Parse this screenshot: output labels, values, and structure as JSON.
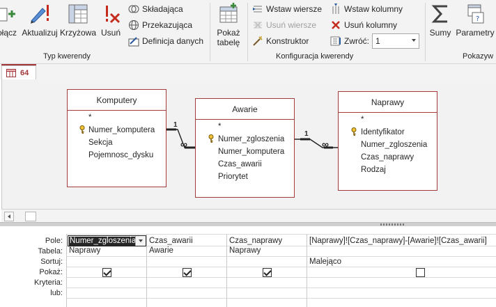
{
  "ribbon": {
    "groups": {
      "query_type": "Typ kwerendy",
      "query_setup": "Konfiguracja kwerendy",
      "show_hide": "Pokazyw"
    },
    "buttons": {
      "append": "ołącz",
      "update": "Aktualizuj",
      "crosstab": "Krzyżowa",
      "delete": "Usuń",
      "union": "Składająca",
      "passthrough": "Przekazująca",
      "data_definition": "Definicja danych",
      "show_table_line1": "Pokaż",
      "show_table_line2": "tabelę",
      "insert_rows": "Wstaw wiersze",
      "delete_rows": "Usuń wiersze",
      "builder": "Konstruktor",
      "insert_columns": "Wstaw kolumny",
      "delete_columns": "Usuń kolumny",
      "return_label": "Zwróć:",
      "return_value": "1",
      "totals": "Sumy",
      "parameters": "Parametry"
    },
    "icons": [
      "append-icon",
      "update-icon",
      "crosstab-icon",
      "delete-query-icon",
      "union-icon",
      "passthrough-icon",
      "data-definition-icon",
      "show-table-icon",
      "insert-rows-icon",
      "delete-rows-icon",
      "builder-icon",
      "insert-columns-icon",
      "delete-columns-icon",
      "return-icon",
      "totals-icon",
      "parameters-icon"
    ]
  },
  "doc_tab": {
    "label": "64"
  },
  "tables": [
    {
      "name": "Komputery",
      "fields": [
        "*",
        "Numer_komputera",
        "Sekcja",
        "Pojemnosc_dysku"
      ],
      "key_index": 1
    },
    {
      "name": "Awarie",
      "fields": [
        "*",
        "Numer_zgloszenia",
        "Numer_komputera",
        "Czas_awarii",
        "Priorytet"
      ],
      "key_index": 1
    },
    {
      "name": "Naprawy",
      "fields": [
        "*",
        "Identyfikator",
        "Numer_zgloszenia",
        "Czas_naprawy",
        "Rodzaj"
      ],
      "key_index": 1
    }
  ],
  "relationships": [
    {
      "one": "1",
      "many": "∞"
    },
    {
      "one": "1",
      "many": "∞"
    }
  ],
  "grid": {
    "row_labels": [
      "Pole:",
      "Tabela:",
      "Sortuj:",
      "Pokaż:",
      "Kryteria:",
      "lub:"
    ],
    "columns": [
      {
        "field": "Numer_zgloszenia",
        "table": "Naprawy",
        "sort": "",
        "show": true
      },
      {
        "field": "Czas_awarii",
        "table": "Awarie",
        "sort": "",
        "show": true
      },
      {
        "field": "Czas_naprawy",
        "table": "Naprawy",
        "sort": "",
        "show": true
      },
      {
        "field": "[Naprawy]![Czas_naprawy]-[Awarie]![Czas_awarii]",
        "table": "",
        "sort": "Malejąco",
        "show": false
      }
    ]
  },
  "colors": {
    "accent": "#a4373a",
    "table_border": "#a33b3b"
  }
}
